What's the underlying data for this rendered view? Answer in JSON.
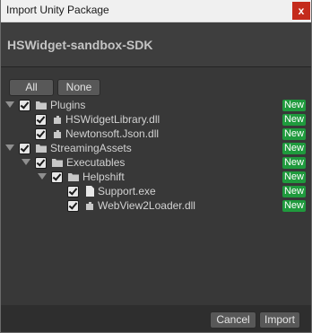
{
  "window": {
    "title": "Import Unity Package",
    "close_glyph": "x"
  },
  "package": {
    "name": "HSWidget-sandbox-SDK"
  },
  "toolbar": {
    "all_label": "All",
    "none_label": "None"
  },
  "tree": {
    "items": [
      {
        "label": "Plugins",
        "type": "folder",
        "checked": true,
        "badge": "New"
      },
      {
        "label": "HSWidgetLibrary.dll",
        "type": "dll",
        "checked": true,
        "badge": "New"
      },
      {
        "label": "Newtonsoft.Json.dll",
        "type": "dll",
        "checked": true,
        "badge": "New"
      },
      {
        "label": "StreamingAssets",
        "type": "folder",
        "checked": true,
        "badge": "New"
      },
      {
        "label": "Executables",
        "type": "folder",
        "checked": true,
        "badge": "New"
      },
      {
        "label": "Helpshift",
        "type": "folder",
        "checked": true,
        "badge": "New"
      },
      {
        "label": "Support.exe",
        "type": "file",
        "checked": true,
        "badge": "New"
      },
      {
        "label": "WebView2Loader.dll",
        "type": "dll",
        "checked": true,
        "badge": "New"
      }
    ]
  },
  "footer": {
    "cancel_label": "Cancel",
    "import_label": "Import"
  },
  "colors": {
    "badge_new": "#1f9a3d",
    "close_button": "#c42b1c"
  }
}
